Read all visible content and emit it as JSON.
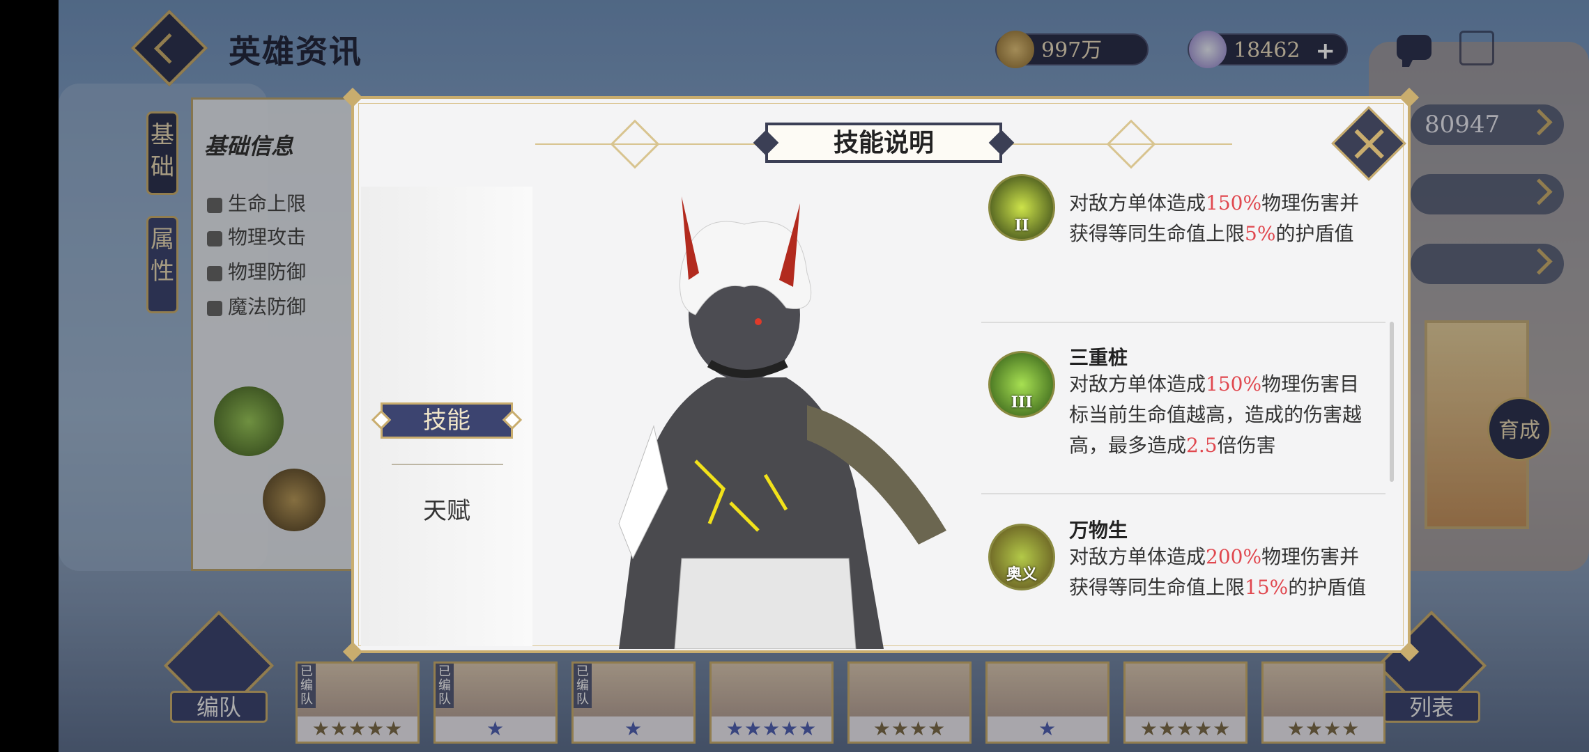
{
  "header": {
    "title": "英雄资讯"
  },
  "resources": [
    {
      "name": "gold",
      "value": "997万",
      "icon": "gold-coin-icon"
    },
    {
      "name": "gem",
      "value": "18462",
      "icon": "crystal-icon",
      "plus": "+"
    }
  ],
  "background": {
    "side_tabs": [
      "基础",
      "属性"
    ],
    "info_title": "基础信息",
    "stats": [
      "生命上限",
      "物理攻击",
      "物理防御",
      "魔法防御"
    ],
    "right_value": "80947",
    "grow_label": "育成",
    "nav": {
      "squad": "编队",
      "list": "列表"
    },
    "squad_tag": "已编队",
    "hero_thumbs": [
      {
        "stars": "★★★★★",
        "tier": "gold",
        "squad": true
      },
      {
        "stars": "★",
        "tier": "blue",
        "squad": true
      },
      {
        "stars": "★",
        "tier": "blue",
        "squad": true
      },
      {
        "stars": "★★★★★",
        "tier": "blue",
        "squad": false
      },
      {
        "stars": "★★★★",
        "tier": "gold",
        "squad": false
      },
      {
        "stars": "★",
        "tier": "blue",
        "squad": false
      },
      {
        "stars": "★★★★★",
        "tier": "gold",
        "squad": false
      },
      {
        "stars": "★★★★",
        "tier": "gold",
        "squad": false
      }
    ]
  },
  "modal": {
    "title": "技能说明",
    "tabs": {
      "active": "技能",
      "inactive": "天赋"
    },
    "skills": [
      {
        "icon_num": "II",
        "name": "",
        "desc_parts": [
          "对敌方单体造成",
          "150%",
          "物理伤害并获得等同生命值上限",
          "5%",
          "的护盾值"
        ]
      },
      {
        "icon_num": "III",
        "name": "三重桩",
        "desc_parts": [
          "对敌方单体造成",
          "150%",
          "物理伤害目标当前生命值越高，造成的伤害越高，最多造成",
          "2.5",
          "倍伤害"
        ]
      },
      {
        "icon_num": "奥义",
        "name": "万物生",
        "desc_parts": [
          "对敌方单体造成",
          "200%",
          "物理伤害并获得等同生命值上限",
          "15%",
          "的护盾值"
        ]
      }
    ]
  },
  "colors": {
    "gold": "#c9ad6e",
    "navy": "#3c4470",
    "highlight": "#e0474e"
  }
}
